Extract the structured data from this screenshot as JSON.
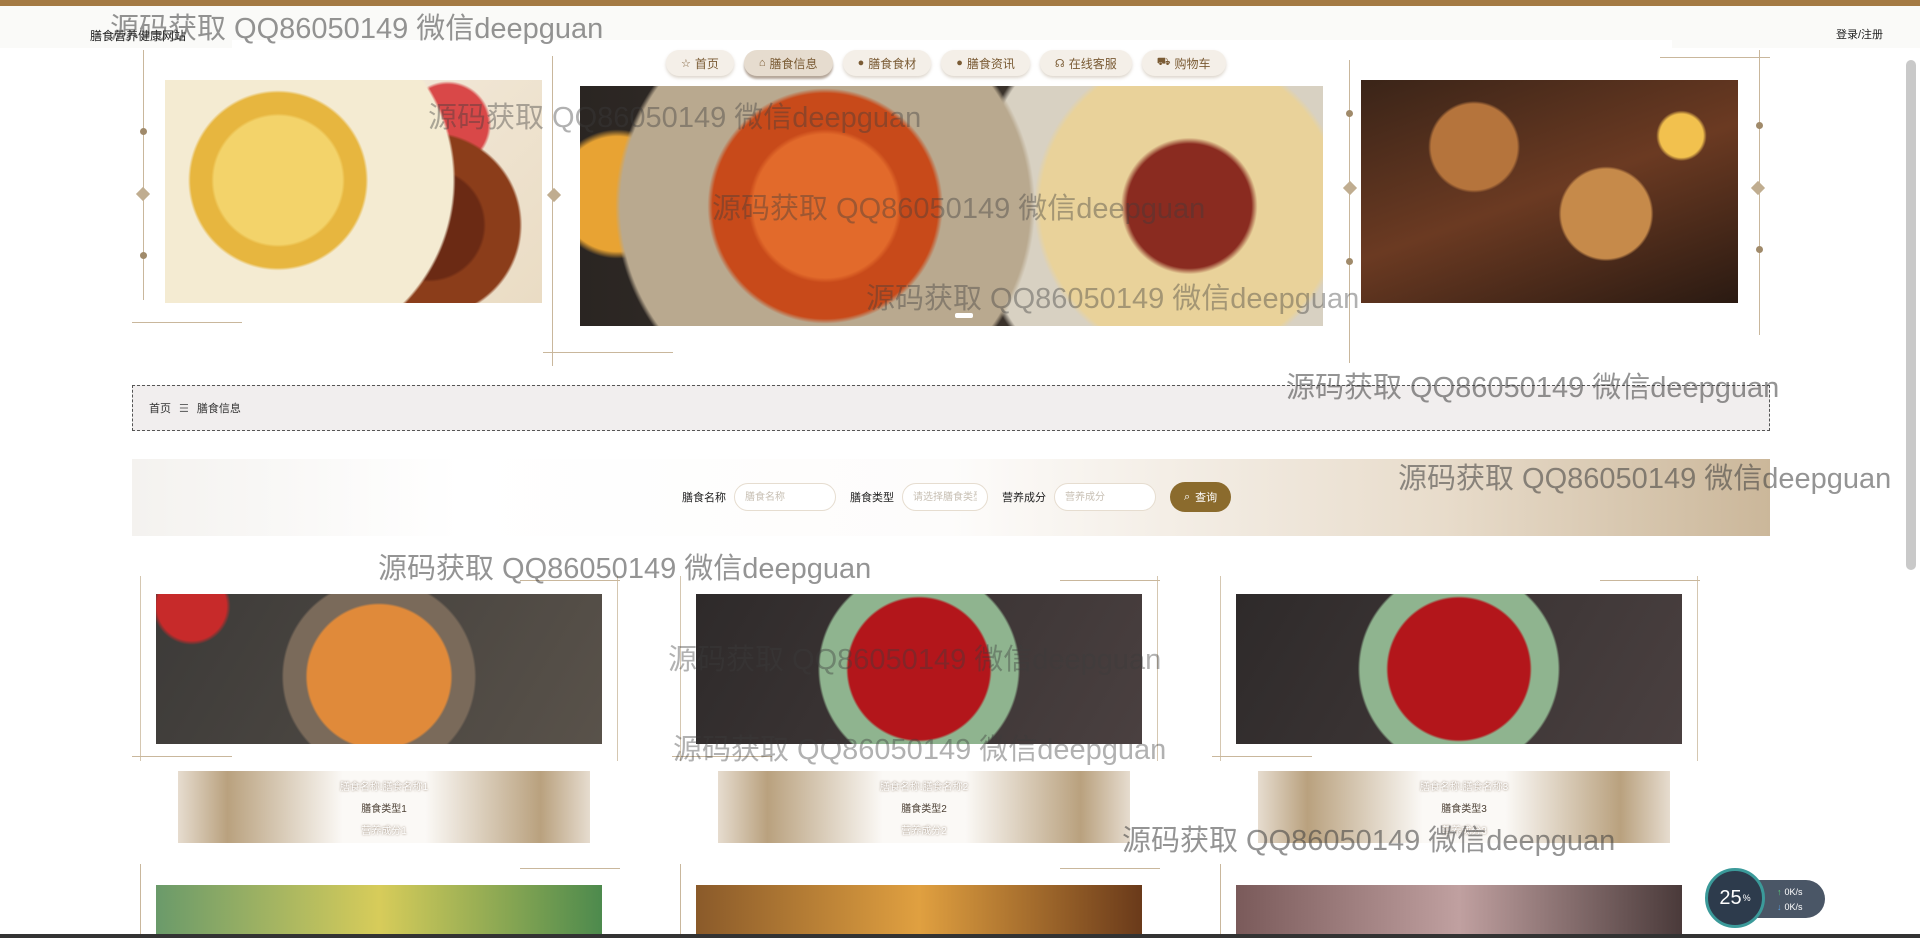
{
  "header": {
    "site_title": "膳食营养健康网站",
    "login": "登录/注册"
  },
  "nav": {
    "items": [
      {
        "label": "首页",
        "icon": "star-icon"
      },
      {
        "label": "膳食信息",
        "icon": "bag-icon",
        "active": true
      },
      {
        "label": "膳食食材",
        "icon": "info-icon"
      },
      {
        "label": "膳食资讯",
        "icon": "question-icon"
      },
      {
        "label": "在线客服",
        "icon": "headset-icon"
      },
      {
        "label": "购物车",
        "icon": "cart-icon"
      }
    ]
  },
  "breadcrumb": {
    "home": "首页",
    "separator": "☰",
    "current": "膳食信息"
  },
  "search": {
    "name_label": "膳食名称",
    "name_placeholder": "膳食名称",
    "type_label": "膳食类型",
    "type_placeholder": "请选择膳食类型",
    "nutrition_label": "营养成分",
    "nutrition_placeholder": "营养成分",
    "button": "查询"
  },
  "cards": [
    {
      "name": "膳食名称:膳食名称1",
      "type": "膳食类型1",
      "nutrition": "营养成分1"
    },
    {
      "name": "膳食名称:膳食名称2",
      "type": "膳食类型2",
      "nutrition": "营养成分2"
    },
    {
      "name": "膳食名称:膳食名称3",
      "type": "膳食类型3",
      "nutrition": "营养成分3"
    }
  ],
  "watermark": "源码获取 QQ86050149 微信deepguan",
  "net_monitor": {
    "percent": "25",
    "percent_unit": "%",
    "upload": "0K/s",
    "download": "0K/s"
  },
  "colors": {
    "accent": "#a47a44",
    "button": "#8b6b2d",
    "nav_text": "#7a5b34"
  }
}
